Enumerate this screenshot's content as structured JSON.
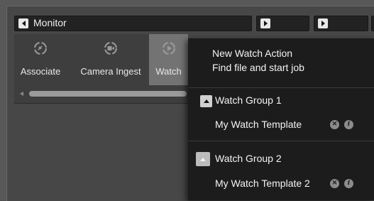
{
  "monitor_header": {
    "label": "Monitor"
  },
  "toolbar": {
    "items": [
      {
        "label": "Associate",
        "icon": "associate-icon"
      },
      {
        "label": "Camera Ingest",
        "icon": "camera-ingest-icon"
      },
      {
        "label": "Watch",
        "icon": "watch-icon",
        "selected": true
      }
    ]
  },
  "menu": {
    "new_action": "New Watch Action",
    "find_file": "Find file and start job",
    "groups": [
      {
        "label": "Watch Group 1",
        "template": "My Watch Template"
      },
      {
        "label": "Watch Group 2",
        "template": "My Watch Template 2"
      }
    ]
  },
  "colors": {
    "background": "#474747",
    "header": "#222222",
    "menu": "#1c1c1c",
    "selected_tool": "#737373",
    "text": "#f4f4f4"
  }
}
